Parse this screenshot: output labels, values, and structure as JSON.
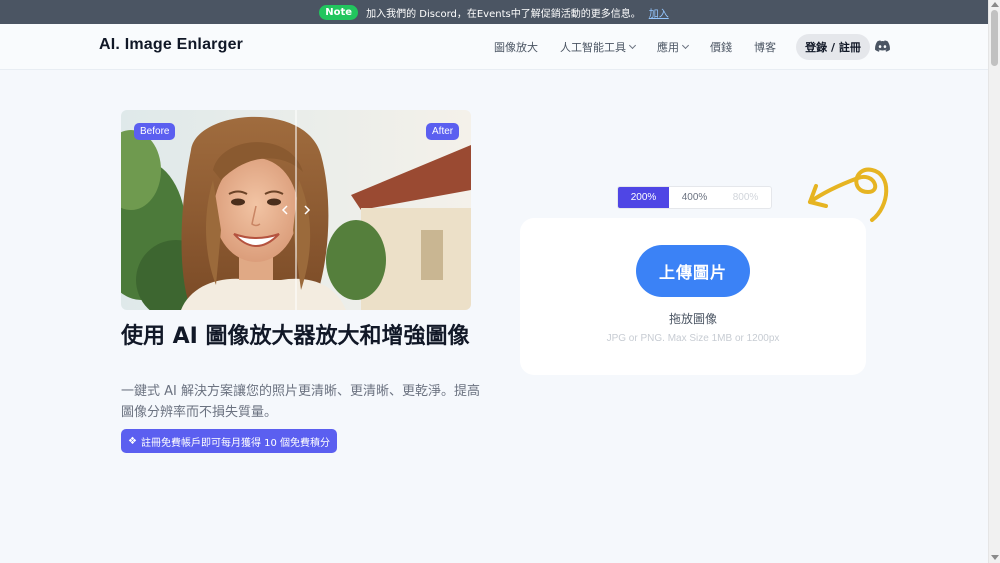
{
  "announcement": {
    "badge": "Note",
    "message": "加入我們的 Discord，在Events中了解促銷活動的更多信息。",
    "link": "加入"
  },
  "nav": {
    "logo": "AI. Image Enlarger",
    "links": [
      {
        "label": "圖像放大"
      },
      {
        "label": "人工智能工具"
      },
      {
        "label": "應用"
      },
      {
        "label": "價錢"
      },
      {
        "label": "博客"
      }
    ],
    "login": "登錄 / 註冊",
    "discord_icon": "discord-icon"
  },
  "hero": {
    "before_label": "Before",
    "after_label": "After",
    "headline": "使用 AI 圖像放大器放大和增強圖像",
    "subtext": "一鍵式 AI 解決方案讓您的照片更清晰、更清晰、更乾淨。提高圖像分辨率而不損失質量。",
    "promo": "註冊免費帳戶即可每月獲得 10 個免費積分"
  },
  "upload": {
    "scales": [
      {
        "label": "200%",
        "state": "active"
      },
      {
        "label": "400%",
        "state": "normal"
      },
      {
        "label": "800%",
        "state": "disabled"
      }
    ],
    "button": "上傳圖片",
    "drop_text": "拖放圖像",
    "limit_text": "JPG or PNG. Max Size 1MB or 1200px"
  },
  "colors": {
    "accent": "#5b5ff0",
    "upload_button": "#3b82f6",
    "note_badge": "#22c55e",
    "announcement_bg": "#4b5563",
    "doodle": "#e6b422"
  }
}
